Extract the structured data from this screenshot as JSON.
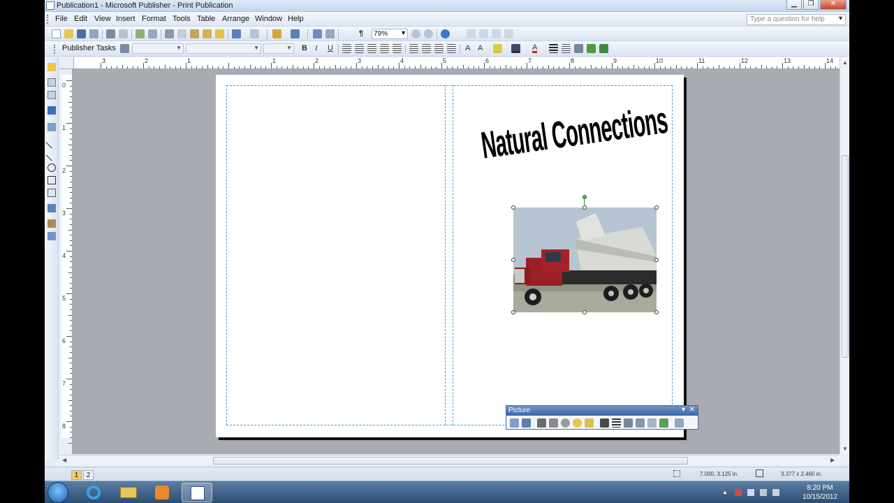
{
  "window": {
    "title": "Publication1 - Microsoft Publisher - Print Publication"
  },
  "menu": {
    "items": [
      "File",
      "Edit",
      "View",
      "Insert",
      "Format",
      "Tools",
      "Table",
      "Arrange",
      "Window",
      "Help"
    ],
    "help_placeholder": "Type a question for help"
  },
  "standard_toolbar": {
    "zoom": "79%"
  },
  "format_toolbar": {
    "tasks_label": "Publisher Tasks",
    "font_style": "",
    "font_name": "",
    "font_size": "",
    "bold": "B",
    "italic": "I",
    "underline": "U"
  },
  "ruler": {
    "h_numbers": [
      "3",
      "2",
      "1",
      "1",
      "2",
      "3",
      "4",
      "5",
      "6",
      "7",
      "8",
      "9",
      "10",
      "11",
      "12",
      "13",
      "14"
    ],
    "v_numbers": [
      "0",
      "1",
      "2",
      "3",
      "4",
      "5",
      "6",
      "7",
      "8"
    ]
  },
  "document": {
    "headline": "Natural Connections",
    "picture_alt": "red dump truck photo"
  },
  "picture_toolbar": {
    "title": "Picture"
  },
  "statusbar": {
    "pages": [
      "1",
      "2"
    ],
    "position": "7.000, 3.125 in.",
    "size": "3.377 x 2.460 in."
  },
  "taskbar": {
    "time": "8:20 PM",
    "date": "10/15/2012"
  }
}
